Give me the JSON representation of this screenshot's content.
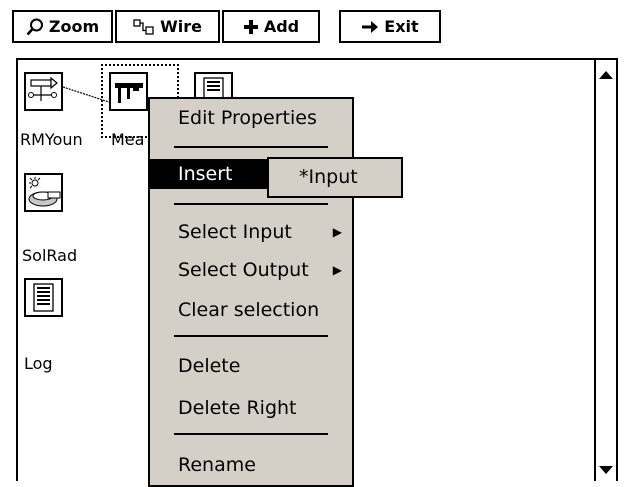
{
  "toolbar": {
    "zoom": {
      "label": "Zoom",
      "icon": "magnifier-icon"
    },
    "wire": {
      "label": "Wire",
      "icon": "wire-icon"
    },
    "add": {
      "label": "Add",
      "icon": "plus-icon"
    },
    "exit": {
      "label": "Exit",
      "icon": "arrow-right-icon"
    }
  },
  "canvas": {
    "blocks": [
      {
        "label": "RMYoun",
        "icon": "wind-sensor-icon"
      },
      {
        "label": "Mea",
        "icon": "caliper-icon",
        "selected": true
      },
      {
        "label": "",
        "icon": "log-icon"
      },
      {
        "label": "SolRad",
        "icon": "solar-radiation-icon"
      },
      {
        "label": "Log",
        "icon": "log-icon"
      }
    ]
  },
  "context_menu": {
    "items": [
      {
        "label": "Edit Properties"
      },
      {
        "label": "Insert",
        "highlighted": true,
        "submenu": true
      },
      {
        "label": "Select Input",
        "submenu": true
      },
      {
        "label": "Select Output",
        "submenu": true
      },
      {
        "label": "Clear selection"
      },
      {
        "label": "Delete"
      },
      {
        "label": "Delete Right"
      },
      {
        "label": "Rename"
      }
    ],
    "submenu": {
      "items": [
        "*Input"
      ]
    }
  },
  "colors": {
    "menu_bg": "#d4d0c8",
    "highlight_bg": "#000000",
    "highlight_fg": "#ffffff"
  }
}
